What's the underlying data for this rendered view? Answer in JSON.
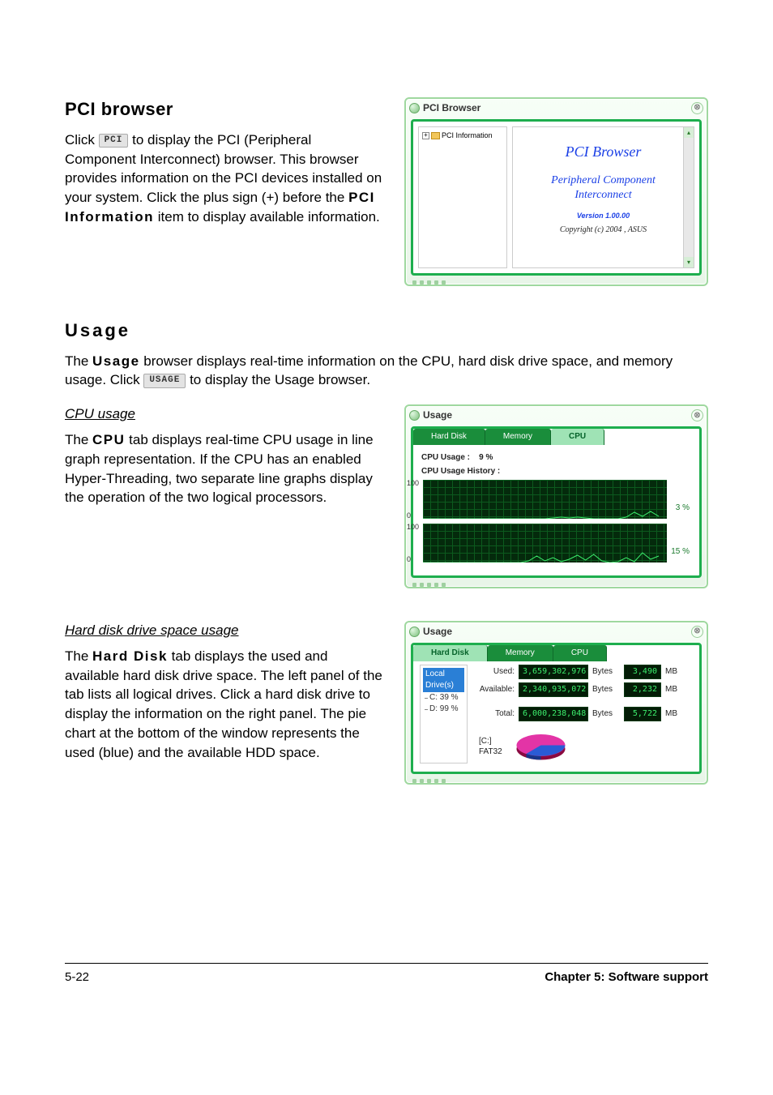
{
  "sections": {
    "pci": {
      "heading": "PCI browser",
      "para_parts": {
        "p1a": "Click ",
        "btn": "PCI",
        "p1b": " to display the PCI (Peripheral Component Interconnect) browser. This browser provides information on the PCI devices installed on your system. Click the plus sign (+) before the ",
        "bold": "PCI Information",
        "p1c": " item to display available information."
      },
      "window": {
        "title": "PCI Browser",
        "tree_item": "PCI Information",
        "logo_line1": "PCI  Browser",
        "logo_line2a": "Peripheral Component",
        "logo_line2b": "Interconnect",
        "version": "Version 1.00.00",
        "copyright": "Copyright (c) 2004 ,  ASUS"
      }
    },
    "usage_intro": {
      "heading": "Usage",
      "p_a": "The ",
      "p_bold": "Usage",
      "p_b": " browser displays real-time information on the CPU, hard disk drive space, and memory usage. Click ",
      "btn": "USAGE",
      "p_c": " to display the Usage browser."
    },
    "cpu": {
      "subhead": "CPU usage",
      "p_a": "The ",
      "p_bold": "CPU",
      "p_b": " tab displays real-time CPU usage in line graph representation. If the CPU has an enabled Hyper-Threading, two separate line graphs display the operation of the two logical processors.",
      "window": {
        "title": "Usage",
        "tabs": {
          "hdd": "Hard Disk",
          "mem": "Memory",
          "cpu": "CPU"
        },
        "cpu_usage_label": "CPU Usage :",
        "cpu_usage_value": "9  %",
        "history_label": "CPU Usage History :",
        "axis_top": "100",
        "axis_bot": "0",
        "pct1": "3 %",
        "pct2": "15 %"
      }
    },
    "hdd": {
      "subhead": "Hard disk drive space usage",
      "p_a": "The ",
      "p_bold": "Hard Disk",
      "p_b": " tab displays the used and available hard disk drive space. The left panel of the tab lists all logical drives. Click a hard disk drive to display the information on the right panel. The pie chart at the bottom of the window represents the used (blue) and the available HDD space.",
      "window": {
        "title": "Usage",
        "tabs": {
          "hdd": "Hard Disk",
          "mem": "Memory",
          "cpu": "CPU"
        },
        "drive_header": "Local Drive(s)",
        "drives": {
          "c": "C:  39 %",
          "d": "D:  99 %"
        },
        "rows": {
          "used": {
            "label": "Used:",
            "bytes": "3,659,302,976",
            "unit1": "Bytes",
            "mb": "3,490",
            "unit2": "MB"
          },
          "avail": {
            "label": "Available:",
            "bytes": "2,340,935,072",
            "unit1": "Bytes",
            "mb": "2,232",
            "unit2": "MB"
          },
          "total": {
            "label": "Total:",
            "bytes": "6,000,238,048",
            "unit1": "Bytes",
            "mb": "5,722",
            "unit2": "MB"
          }
        },
        "pie_label1": "[C:]",
        "pie_label2": "FAT32"
      }
    }
  },
  "footer": {
    "left": "5-22",
    "right": "Chapter 5: Software support"
  },
  "chart_data": [
    {
      "type": "line",
      "title": "CPU Usage History (core 0)",
      "ylim": [
        0,
        100
      ],
      "current_pct": 3,
      "values": [
        0,
        0,
        0,
        0,
        0,
        0,
        0,
        0,
        0,
        0,
        0,
        0,
        0,
        0,
        0,
        2,
        5,
        3,
        2,
        4,
        2,
        0,
        0,
        0,
        0,
        6,
        18,
        8,
        22,
        6
      ]
    },
    {
      "type": "line",
      "title": "CPU Usage History (core 1)",
      "ylim": [
        0,
        100
      ],
      "current_pct": 15,
      "values": [
        0,
        0,
        0,
        0,
        0,
        0,
        0,
        0,
        0,
        0,
        0,
        0,
        5,
        18,
        6,
        14,
        4,
        10,
        20,
        8,
        22,
        6,
        0,
        0,
        4,
        14,
        4,
        26,
        12,
        18
      ]
    },
    {
      "type": "pie",
      "title": "[C:] FAT32 disk usage",
      "series": [
        {
          "name": "Used",
          "value": 3659302976,
          "mb": 3490,
          "color_hint": "blue"
        },
        {
          "name": "Available",
          "value": 2340935072,
          "mb": 2232,
          "color_hint": "magenta"
        }
      ],
      "total_bytes": 6000238048,
      "total_mb": 5722
    }
  ]
}
